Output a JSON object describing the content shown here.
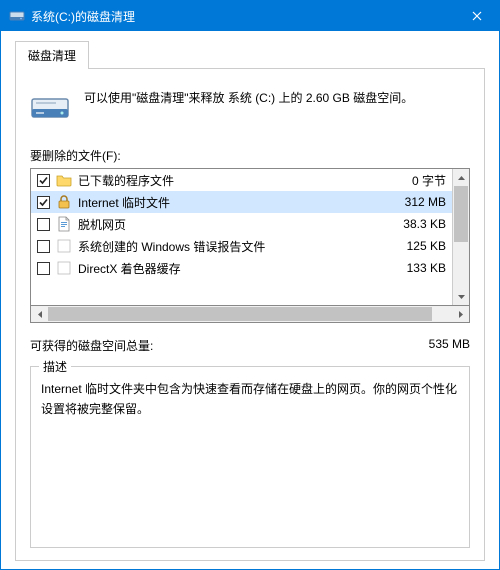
{
  "window": {
    "title": "系统(C:)的磁盘清理"
  },
  "tab": {
    "label": "磁盘清理"
  },
  "intro": {
    "text": "可以使用\"磁盘清理\"来释放 系统 (C:) 上的 2.60 GB 磁盘空间。"
  },
  "list_label": "要删除的文件(F):",
  "files": [
    {
      "checked": true,
      "icon": "folder",
      "name": "已下载的程序文件",
      "size": "0 字节",
      "selected": false
    },
    {
      "checked": true,
      "icon": "lock",
      "name": "Internet 临时文件",
      "size": "312 MB",
      "selected": true
    },
    {
      "checked": false,
      "icon": "page",
      "name": "脱机网页",
      "size": "38.3 KB",
      "selected": false
    },
    {
      "checked": false,
      "icon": "blank",
      "name": "系统创建的 Windows 错误报告文件",
      "size": "125 KB",
      "selected": false
    },
    {
      "checked": false,
      "icon": "blank",
      "name": "DirectX 着色器缓存",
      "size": "133 KB",
      "selected": false
    }
  ],
  "total": {
    "label": "可获得的磁盘空间总量:",
    "value": "535 MB"
  },
  "description": {
    "title": "描述",
    "text": "Internet 临时文件夹中包含为快速查看而存储在硬盘上的网页。你的网页个性化设置将被完整保留。"
  }
}
